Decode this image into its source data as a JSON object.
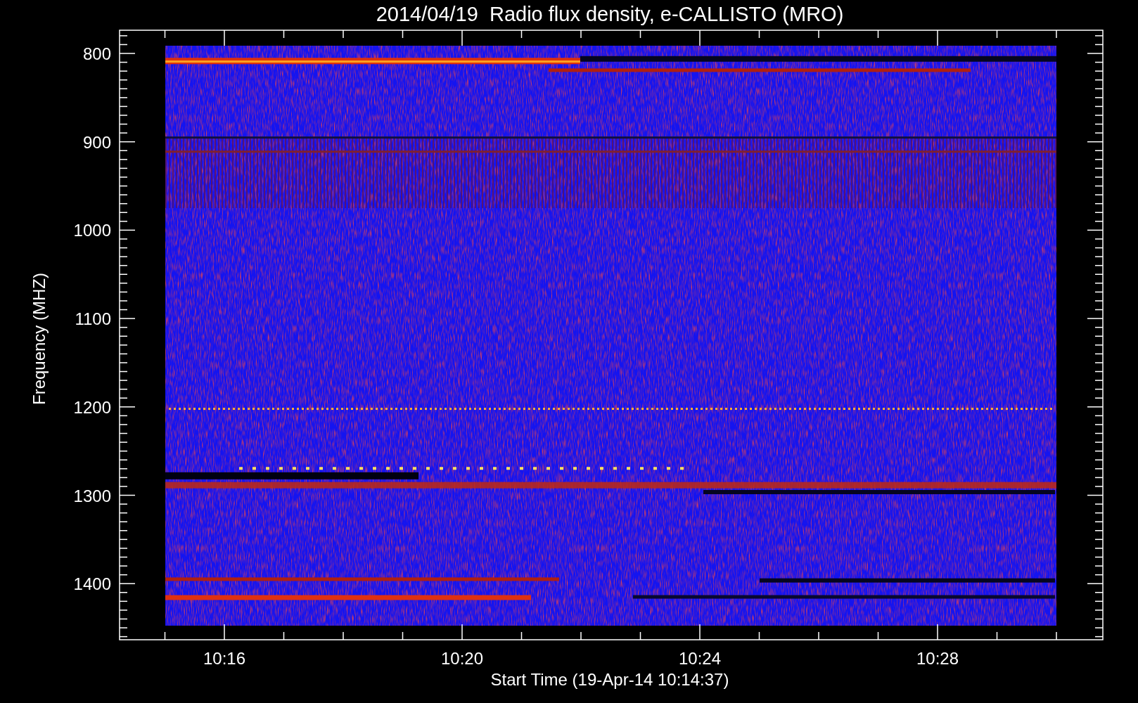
{
  "title": "2014/04/19  Radio flux density, e-CALLISTO (MRO)",
  "y_axis": {
    "label": "Frequency (MHZ)",
    "ticks": [
      "800",
      "900",
      "1000",
      "1100",
      "1200",
      "1300",
      "1400"
    ]
  },
  "x_axis": {
    "label": "Start Time (19-Apr-14 10:14:37)",
    "ticks": [
      "10:16",
      "10:20",
      "10:24",
      "10:28"
    ]
  }
}
